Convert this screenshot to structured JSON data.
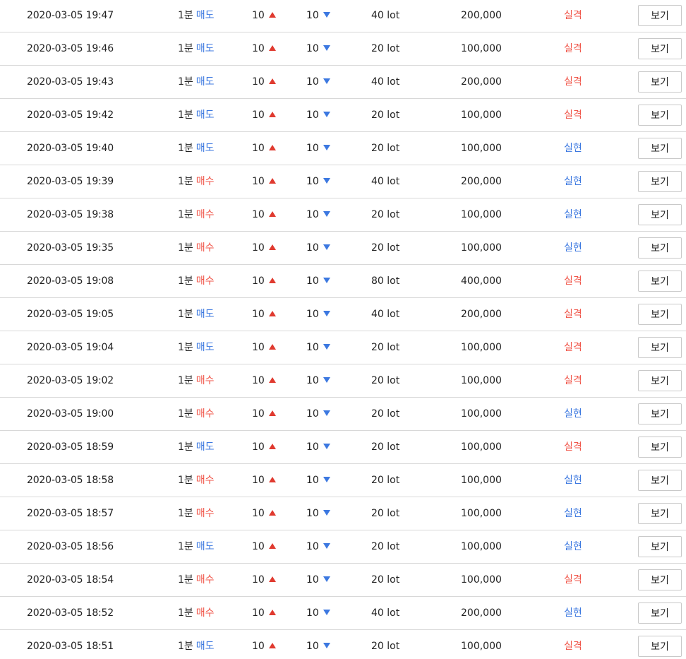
{
  "colors": {
    "sell": "#3c78e0",
    "buy": "#f0564a",
    "loss": "#f0564a",
    "profit": "#3c78e0",
    "up_arrow": "#e03a2f",
    "down_arrow": "#3c78e0"
  },
  "rows": [
    {
      "datetime": "2020-03-05 19:47",
      "timeframe": "1분",
      "side": "매도",
      "side_type": "sell",
      "up": "10",
      "down": "10",
      "lot": "40 lot",
      "amount": "200,000",
      "result": "실격",
      "result_type": "loss",
      "button": "보기"
    },
    {
      "datetime": "2020-03-05 19:46",
      "timeframe": "1분",
      "side": "매도",
      "side_type": "sell",
      "up": "10",
      "down": "10",
      "lot": "20 lot",
      "amount": "100,000",
      "result": "실격",
      "result_type": "loss",
      "button": "보기"
    },
    {
      "datetime": "2020-03-05 19:43",
      "timeframe": "1분",
      "side": "매도",
      "side_type": "sell",
      "up": "10",
      "down": "10",
      "lot": "40 lot",
      "amount": "200,000",
      "result": "실격",
      "result_type": "loss",
      "button": "보기"
    },
    {
      "datetime": "2020-03-05 19:42",
      "timeframe": "1분",
      "side": "매도",
      "side_type": "sell",
      "up": "10",
      "down": "10",
      "lot": "20 lot",
      "amount": "100,000",
      "result": "실격",
      "result_type": "loss",
      "button": "보기"
    },
    {
      "datetime": "2020-03-05 19:40",
      "timeframe": "1분",
      "side": "매도",
      "side_type": "sell",
      "up": "10",
      "down": "10",
      "lot": "20 lot",
      "amount": "100,000",
      "result": "실현",
      "result_type": "profit",
      "button": "보기"
    },
    {
      "datetime": "2020-03-05 19:39",
      "timeframe": "1분",
      "side": "매수",
      "side_type": "buy",
      "up": "10",
      "down": "10",
      "lot": "40 lot",
      "amount": "200,000",
      "result": "실현",
      "result_type": "profit",
      "button": "보기"
    },
    {
      "datetime": "2020-03-05 19:38",
      "timeframe": "1분",
      "side": "매수",
      "side_type": "buy",
      "up": "10",
      "down": "10",
      "lot": "20 lot",
      "amount": "100,000",
      "result": "실현",
      "result_type": "profit",
      "button": "보기"
    },
    {
      "datetime": "2020-03-05 19:35",
      "timeframe": "1분",
      "side": "매수",
      "side_type": "buy",
      "up": "10",
      "down": "10",
      "lot": "20 lot",
      "amount": "100,000",
      "result": "실현",
      "result_type": "profit",
      "button": "보기"
    },
    {
      "datetime": "2020-03-05 19:08",
      "timeframe": "1분",
      "side": "매수",
      "side_type": "buy",
      "up": "10",
      "down": "10",
      "lot": "80 lot",
      "amount": "400,000",
      "result": "실격",
      "result_type": "loss",
      "button": "보기"
    },
    {
      "datetime": "2020-03-05 19:05",
      "timeframe": "1분",
      "side": "매도",
      "side_type": "sell",
      "up": "10",
      "down": "10",
      "lot": "40 lot",
      "amount": "200,000",
      "result": "실격",
      "result_type": "loss",
      "button": "보기"
    },
    {
      "datetime": "2020-03-05 19:04",
      "timeframe": "1분",
      "side": "매도",
      "side_type": "sell",
      "up": "10",
      "down": "10",
      "lot": "20 lot",
      "amount": "100,000",
      "result": "실격",
      "result_type": "loss",
      "button": "보기"
    },
    {
      "datetime": "2020-03-05 19:02",
      "timeframe": "1분",
      "side": "매수",
      "side_type": "buy",
      "up": "10",
      "down": "10",
      "lot": "20 lot",
      "amount": "100,000",
      "result": "실격",
      "result_type": "loss",
      "button": "보기"
    },
    {
      "datetime": "2020-03-05 19:00",
      "timeframe": "1분",
      "side": "매수",
      "side_type": "buy",
      "up": "10",
      "down": "10",
      "lot": "20 lot",
      "amount": "100,000",
      "result": "실현",
      "result_type": "profit",
      "button": "보기"
    },
    {
      "datetime": "2020-03-05 18:59",
      "timeframe": "1분",
      "side": "매도",
      "side_type": "sell",
      "up": "10",
      "down": "10",
      "lot": "20 lot",
      "amount": "100,000",
      "result": "실격",
      "result_type": "loss",
      "button": "보기"
    },
    {
      "datetime": "2020-03-05 18:58",
      "timeframe": "1분",
      "side": "매수",
      "side_type": "buy",
      "up": "10",
      "down": "10",
      "lot": "20 lot",
      "amount": "100,000",
      "result": "실현",
      "result_type": "profit",
      "button": "보기"
    },
    {
      "datetime": "2020-03-05 18:57",
      "timeframe": "1분",
      "side": "매수",
      "side_type": "buy",
      "up": "10",
      "down": "10",
      "lot": "20 lot",
      "amount": "100,000",
      "result": "실현",
      "result_type": "profit",
      "button": "보기"
    },
    {
      "datetime": "2020-03-05 18:56",
      "timeframe": "1분",
      "side": "매도",
      "side_type": "sell",
      "up": "10",
      "down": "10",
      "lot": "20 lot",
      "amount": "100,000",
      "result": "실현",
      "result_type": "profit",
      "button": "보기"
    },
    {
      "datetime": "2020-03-05 18:54",
      "timeframe": "1분",
      "side": "매수",
      "side_type": "buy",
      "up": "10",
      "down": "10",
      "lot": "20 lot",
      "amount": "100,000",
      "result": "실격",
      "result_type": "loss",
      "button": "보기"
    },
    {
      "datetime": "2020-03-05 18:52",
      "timeframe": "1분",
      "side": "매수",
      "side_type": "buy",
      "up": "10",
      "down": "10",
      "lot": "40 lot",
      "amount": "200,000",
      "result": "실현",
      "result_type": "profit",
      "button": "보기"
    },
    {
      "datetime": "2020-03-05 18:51",
      "timeframe": "1분",
      "side": "매도",
      "side_type": "sell",
      "up": "10",
      "down": "10",
      "lot": "20 lot",
      "amount": "100,000",
      "result": "실격",
      "result_type": "loss",
      "button": "보기"
    }
  ]
}
